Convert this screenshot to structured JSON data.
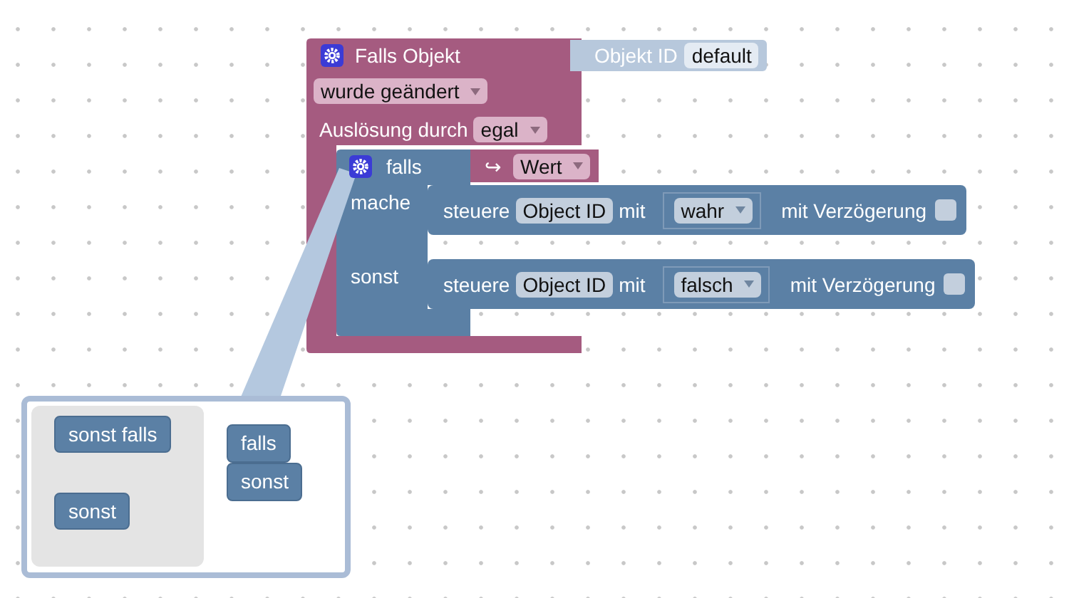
{
  "event_block": {
    "title": "Falls Objekt",
    "object_label": "Objekt ID",
    "object_value": "default",
    "trigger": "wurde geändert",
    "trigger_label": "Auslösung durch",
    "trigger_value": "egal"
  },
  "if_block": {
    "label": "falls",
    "arrow": "↪",
    "condition": "Wert",
    "do_label": "mache",
    "else_label": "sonst"
  },
  "actions": [
    {
      "label": "steuere",
      "target": "Object ID",
      "with": "mit",
      "value": "wahr",
      "delay_label": "mit Verzögerung",
      "delay": false
    },
    {
      "label": "steuere",
      "target": "Object ID",
      "with": "mit",
      "value": "falsch",
      "delay_label": "mit Verzögerung",
      "delay": false
    }
  ],
  "mutator": {
    "flyout": [
      {
        "label": "sonst falls"
      },
      {
        "label": "sonst"
      }
    ],
    "stack": [
      {
        "label": "falls"
      },
      {
        "label": "sonst"
      }
    ]
  }
}
